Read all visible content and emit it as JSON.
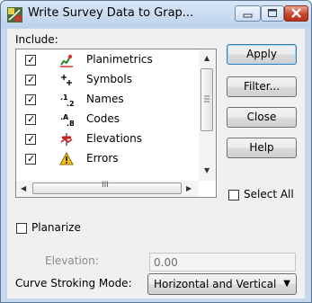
{
  "window": {
    "title": "Write Survey Data to Grap...",
    "title_icon": "survey-data-icon"
  },
  "caption_buttons": {
    "minimize_icon": "minimize-icon",
    "maximize_icon": "maximize-icon",
    "close_icon": "close-icon"
  },
  "include": {
    "label": "Include:",
    "items": [
      {
        "label": "Planimetrics",
        "checked": true,
        "icon": "planimetrics-icon"
      },
      {
        "label": "Symbols",
        "checked": true,
        "icon": "symbols-icon"
      },
      {
        "label": "Names",
        "checked": true,
        "icon": "names-icon"
      },
      {
        "label": "Codes",
        "checked": true,
        "icon": "codes-icon"
      },
      {
        "label": "Elevations",
        "checked": true,
        "icon": "elevations-icon"
      },
      {
        "label": "Errors",
        "checked": true,
        "icon": "errors-icon"
      }
    ],
    "hscroll_grip": "III"
  },
  "buttons": {
    "apply": "Apply",
    "filter": "Filter...",
    "close": "Close",
    "help": "Help"
  },
  "select_all": {
    "label": "Select All",
    "checked": false
  },
  "planarize": {
    "label": "Planarize",
    "checked": false
  },
  "elevation": {
    "label": "Elevation:",
    "value": "0.00"
  },
  "curve_stroking": {
    "label": "Curve Stroking Mode:",
    "value": "Horizontal and Vertical"
  },
  "colors": {
    "title_bar": "#bcd2ec",
    "dialog_bg": "#f0f0f0",
    "close_button": "#c9452b"
  }
}
